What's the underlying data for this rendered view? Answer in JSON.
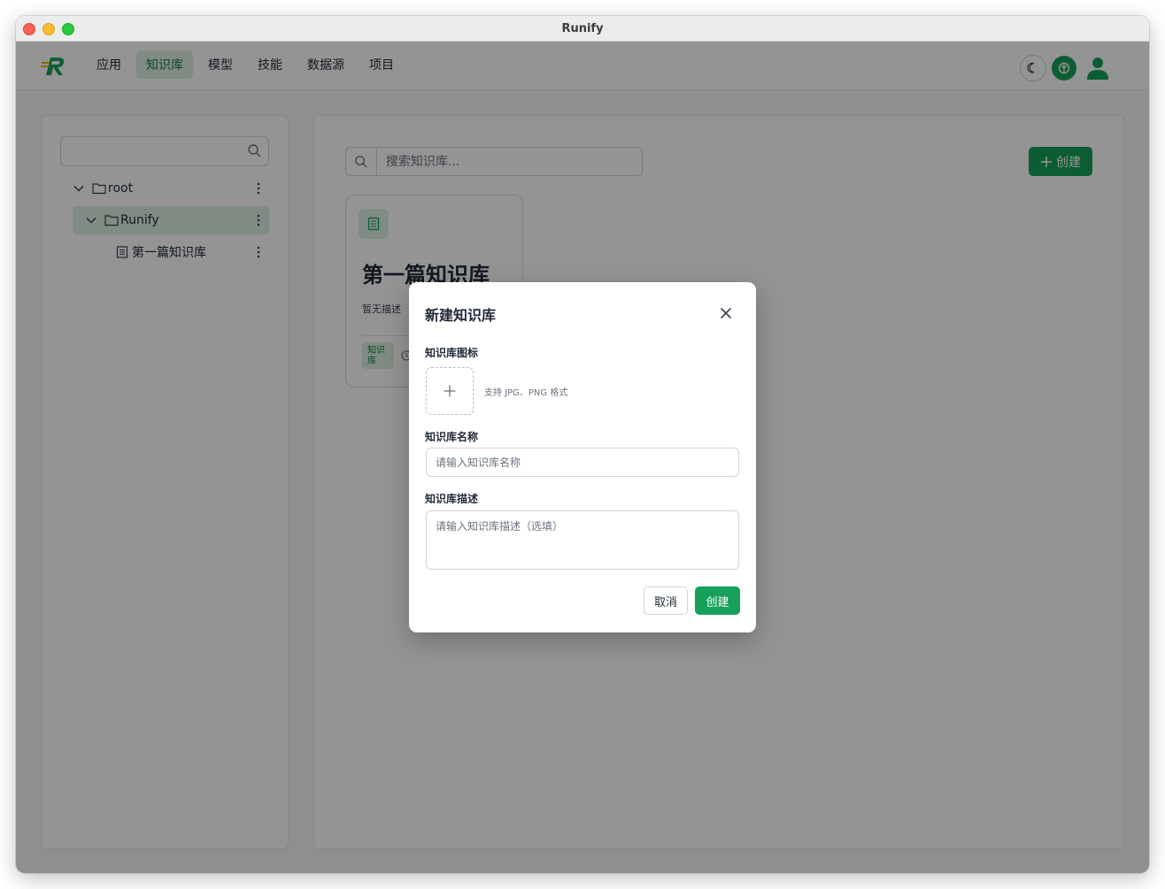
{
  "window": {
    "title": "Runify"
  },
  "nav": {
    "items": [
      {
        "label": "应用"
      },
      {
        "label": "知识库",
        "active": true
      },
      {
        "label": "模型"
      },
      {
        "label": "技能"
      },
      {
        "label": "数据源"
      },
      {
        "label": "项目"
      }
    ]
  },
  "topbar": {
    "icons": [
      "moon-icon",
      "brain-icon",
      "user-icon"
    ]
  },
  "tree": {
    "search_placeholder": "",
    "nodes": [
      {
        "label": "root",
        "icon": "folder-icon",
        "expanded": true
      },
      {
        "label": "Runify",
        "icon": "folder-icon",
        "expanded": true,
        "selected": true
      },
      {
        "label": "第一篇知识库",
        "icon": "document-icon"
      }
    ]
  },
  "main": {
    "search_placeholder": "搜索知识库...",
    "create_label": "创建",
    "card": {
      "title": "第一篇知识库",
      "description": "暂无描述",
      "tag": "知识库"
    }
  },
  "dialog": {
    "title": "新建知识库",
    "icon_label": "知识库图标",
    "icon_hint": "支持 JPG、PNG 格式",
    "name_label": "知识库名称",
    "name_placeholder": "请输入知识库名称",
    "desc_label": "知识库描述",
    "desc_placeholder": "请输入知识库描述（选填）",
    "cancel_label": "取消",
    "create_label": "创建"
  },
  "colors": {
    "accent": "#16a05a",
    "accent_light": "#dcefe4"
  }
}
